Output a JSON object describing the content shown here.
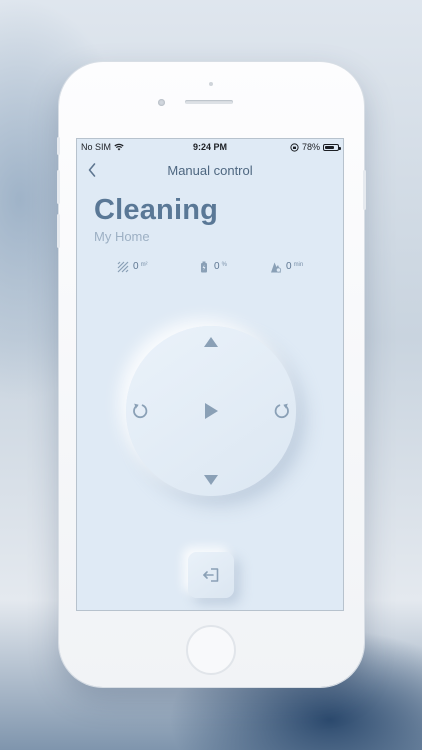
{
  "status_bar": {
    "carrier": "No SIM",
    "time": "9:24 PM",
    "battery_percent": "78%",
    "battery_level": 0.78
  },
  "nav": {
    "back_icon": "chevron-left-icon",
    "title": "Manual control"
  },
  "header": {
    "title": "Cleaning",
    "subtitle": "My Home"
  },
  "stats": [
    {
      "icon": "area-icon",
      "value": "0",
      "unit": "m²"
    },
    {
      "icon": "battery-icon",
      "value": "0",
      "unit": "%"
    },
    {
      "icon": "time-icon",
      "value": "0",
      "unit": "min"
    }
  ],
  "controls": {
    "up": "triangle-up-icon",
    "down": "triangle-down-icon",
    "rotate_left": "rotate-left-icon",
    "rotate_right": "rotate-right-icon",
    "start": "play-icon",
    "exit": "exit-icon"
  },
  "colors": {
    "screen_bg": "#dfeaf5",
    "accent": "#5a7896",
    "icon": "#8aa0b6"
  }
}
